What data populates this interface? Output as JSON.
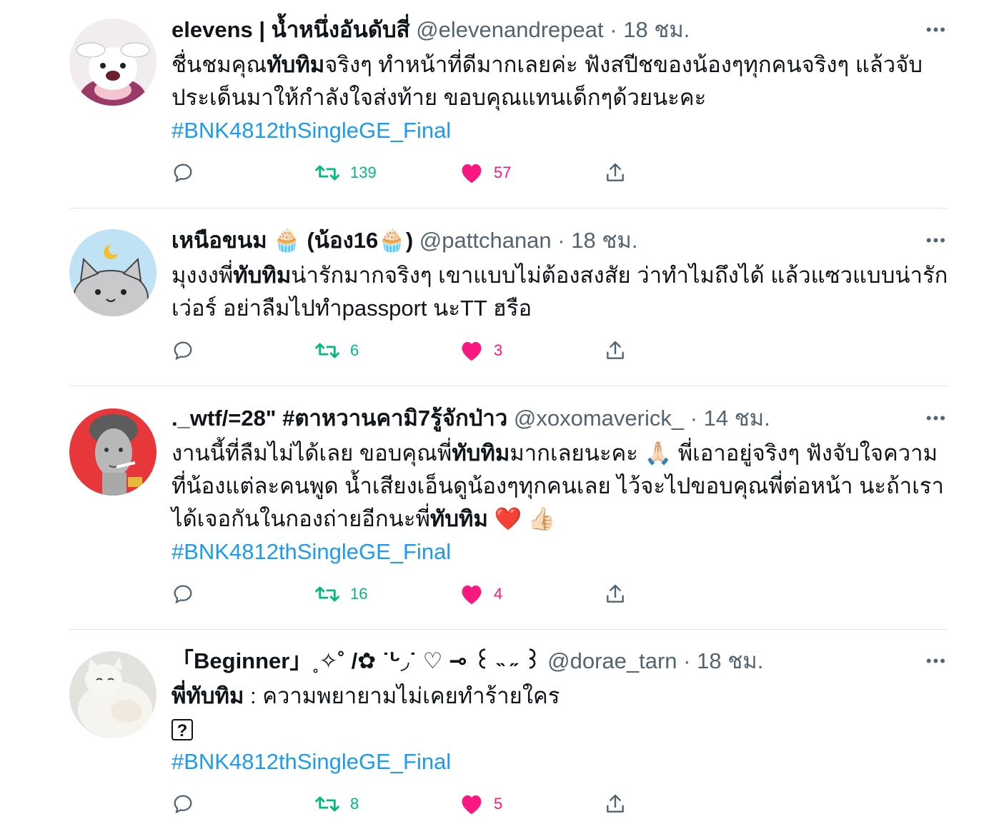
{
  "tweets": [
    {
      "name": "elevens | น้ำหนึ่งอันดับสี่",
      "handle": "@elevenandrepeat",
      "sep": "·",
      "time": "18 ชม.",
      "more": "•••",
      "text": [
        {
          "t": "ชื่นชมคุณ",
          "b": false
        },
        {
          "t": "ทับทิม",
          "b": true
        },
        {
          "t": "จริงๆ ทำหน้าที่ดีมากเลยค่ะ ฟังสปีชของน้องๆทุกคนจริงๆ แล้วจับประเด็นมาให้กำลังใจส่งท้าย ขอบคุณแทนเด็กๆด้วยนะคะ",
          "b": false
        }
      ],
      "hashtag": "#BNK4812thSingleGE_Final",
      "retweets": "139",
      "likes": "57"
    },
    {
      "name": "เหนือขนม 🧁 (น้อง16🧁)",
      "handle": "@pattchanan",
      "sep": "·",
      "time": "18 ชม.",
      "more": "•••",
      "text": [
        {
          "t": "มุงงงพี่",
          "b": false
        },
        {
          "t": "ทับทิม",
          "b": true
        },
        {
          "t": "น่ารักมากจริงๆ เขาแบบไม่ต้องสงสัย ว่าทำไมถึงได้ แล้วแซวแบบน่ารักเว่อร์ อย่าลืมไปทำpassport นะTT ฮรือ",
          "b": false
        }
      ],
      "hashtag": "",
      "retweets": "6",
      "likes": "3"
    },
    {
      "name": "._wtf/=28\" #ตาหวานคามิ7รู้จักป่าว",
      "handle": "@xoxomaverick_",
      "sep": "·",
      "time": "14 ชม.",
      "more": "•••",
      "text": [
        {
          "t": "งานนี้ที่ลืมไม่ได้เลย ขอบคุณพี่",
          "b": false
        },
        {
          "t": "ทับทิม",
          "b": true
        },
        {
          "t": "มากเลยนะคะ 🙏🏻 พี่เอาอยู่จริงๆ ฟังจับใจความที่น้องแต่ละคนพูด น้ำเสียงเอ็นดูน้องๆทุกคนเลย ไว้จะไปขอบคุณพี่ต่อหน้า นะถ้าเราได้เจอกันในกองถ่ายอีกนะพี่",
          "b": false
        },
        {
          "t": "ทับทิม",
          "b": true
        },
        {
          "t": " ❤️ 👍🏻",
          "b": false
        }
      ],
      "hashtag": "#BNK4812thSingleGE_Final",
      "retweets": "16",
      "likes": "4"
    },
    {
      "name": "「Beginner」˳✧˚ /✿ ˙ᒡ◞˙ ♡ ⊸ ꒰ ˵ ˶ ꒱",
      "handle": "@dorae_tarn",
      "sep": "·",
      "time": "18 ชม.",
      "more": "•••",
      "text": [
        {
          "t": "พี่",
          "b": true
        },
        {
          "t": "ทับทิม",
          "b": true
        },
        {
          "t": " : ความพยายามไม่เคยทำร้ายใคร",
          "b": false
        }
      ],
      "box": "?",
      "hashtag": "#BNK4812thSingleGE_Final",
      "retweets": "8",
      "likes": "5"
    }
  ],
  "icons": {
    "reply": "reply-icon",
    "retweet": "retweet-icon",
    "like": "heart-icon",
    "share": "share-icon"
  },
  "colors": {
    "link": "#1d9bf0",
    "retweet": "#00ba7c",
    "like": "#f91880",
    "secondary": "#536471"
  }
}
